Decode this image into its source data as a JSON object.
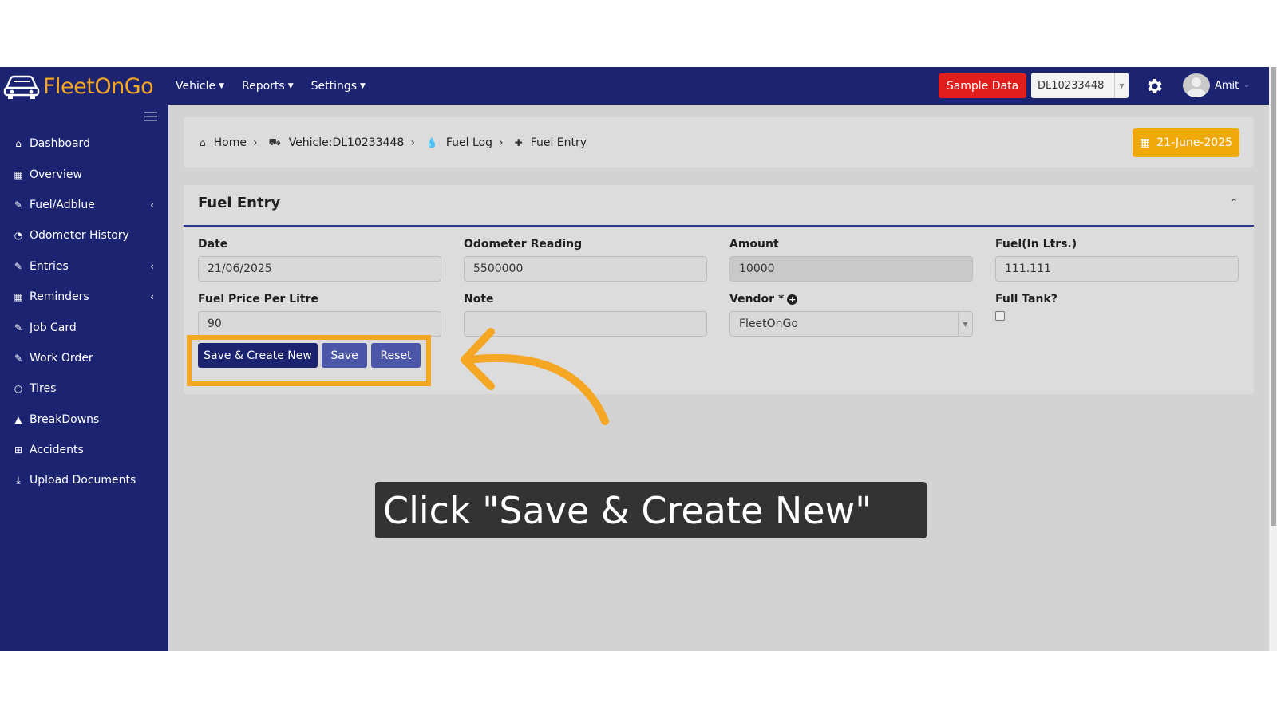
{
  "app": {
    "logo_text": "FleetOnGo",
    "brand_color": "#f5a623",
    "nav_color": "#1c2472"
  },
  "topnav": {
    "menus": [
      {
        "label": "Vehicle",
        "icon": "chevron-down-icon"
      },
      {
        "label": "Reports",
        "icon": "chevron-down-icon"
      },
      {
        "label": "Settings",
        "icon": "chevron-down-icon"
      }
    ],
    "sample_data_label": "Sample Data",
    "vehicle_select_value": "DL10233448",
    "user_name": "Amit"
  },
  "sidebar": {
    "items": [
      {
        "label": "Dashboard",
        "icon": "home-icon",
        "has_submenu": false
      },
      {
        "label": "Overview",
        "icon": "grid-icon",
        "has_submenu": false
      },
      {
        "label": "Fuel/Adblue",
        "icon": "edit-icon",
        "has_submenu": true
      },
      {
        "label": "Odometer History",
        "icon": "gauge-icon",
        "has_submenu": false
      },
      {
        "label": "Entries",
        "icon": "edit-icon",
        "has_submenu": true
      },
      {
        "label": "Reminders",
        "icon": "calendar-icon",
        "has_submenu": true
      },
      {
        "label": "Job Card",
        "icon": "edit-icon",
        "has_submenu": false
      },
      {
        "label": "Work Order",
        "icon": "edit-icon",
        "has_submenu": false
      },
      {
        "label": "Tires",
        "icon": "circle-icon",
        "has_submenu": false
      },
      {
        "label": "BreakDowns",
        "icon": "warning-icon",
        "has_submenu": false
      },
      {
        "label": "Accidents",
        "icon": "plus-square-icon",
        "has_submenu": false
      },
      {
        "label": "Upload Documents",
        "icon": "download-icon",
        "has_submenu": false
      }
    ]
  },
  "breadcrumb": {
    "items": [
      {
        "label": "Home",
        "icon": "home-icon"
      },
      {
        "label": "Vehicle:DL10233448",
        "icon": "truck-icon"
      },
      {
        "label": "Fuel Log",
        "icon": "drop-icon"
      },
      {
        "label": "Fuel Entry",
        "icon": "plus-icon"
      }
    ],
    "date_label": "21-June-2025"
  },
  "form": {
    "title": "Fuel Entry",
    "fields": {
      "date": {
        "label": "Date",
        "value": "21/06/2025"
      },
      "odometer": {
        "label": "Odometer Reading",
        "value": "5500000"
      },
      "amount": {
        "label": "Amount",
        "value": "10000"
      },
      "fuel": {
        "label": "Fuel(In Ltrs.)",
        "value": "111.111"
      },
      "price": {
        "label": "Fuel Price Per Litre",
        "value": "90"
      },
      "note": {
        "label": "Note",
        "value": ""
      },
      "vendor": {
        "label": "Vendor *",
        "value": "FleetOnGo"
      },
      "full_tank": {
        "label": "Full Tank?",
        "checked": false
      }
    },
    "buttons": {
      "save_create_new": "Save & Create New",
      "save": "Save",
      "reset": "Reset"
    }
  },
  "tutorial": {
    "caption": "Click \"Save & Create New\"",
    "highlight_color": "#f5a623"
  }
}
